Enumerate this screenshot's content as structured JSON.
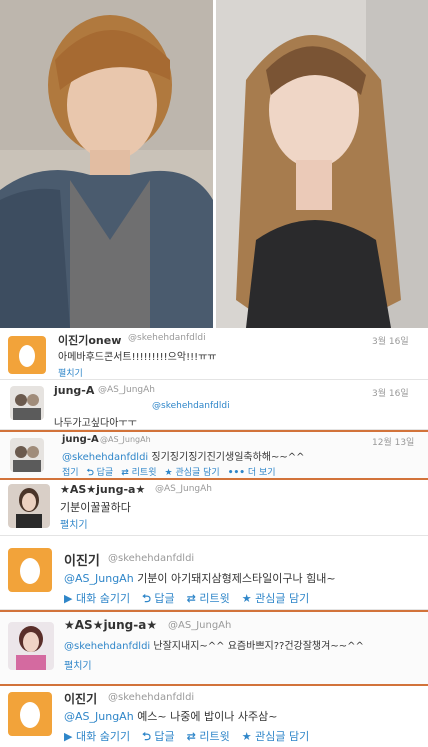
{
  "tweets": [
    {
      "name": "이진기onew",
      "handle": "@skehehdanfdldi",
      "date": "3월 16일",
      "text": "아메바후드콘서트!!!!!!!!!으악!!!ㅠㅠ",
      "expand": "펼치기"
    },
    {
      "name": "jung-A",
      "handle": "@AS_JungAh",
      "date": "3월 16일",
      "mention": "@skehehdanfdldi",
      "text": "나두가고싶다아ㅜㅜ"
    },
    {
      "name": "jung-A",
      "handle": "@AS_JungAh",
      "date": "12월 13일",
      "mention": "@skehehdanfdldi",
      "text": "징기징기징기진기생일축하해~~^^",
      "actions": [
        "접기",
        "답글",
        "리트윗",
        "관심글 담기",
        "더 보기"
      ]
    },
    {
      "name": "★AS★jung-a★",
      "handle": "@AS_JungAh",
      "text": "기분이꿀꿀하다",
      "expand": "펼치기"
    },
    {
      "name": "이진기",
      "handle": "@skehehdanfdldi",
      "mention": "@AS_JungAh",
      "text": "기분이 아기돼지삼형제스타일이구나 힘내~",
      "actions": [
        "대화 숨기기",
        "답글",
        "리트윗",
        "관심글 담기"
      ]
    },
    {
      "name": "★AS★jung-a★",
      "handle": "@AS_JungAh",
      "mention": "@skehehdanfdldi",
      "text": "난잘지내지~^^ 요즘바쁘지??건강잘챙겨~~^^",
      "expand": "펼치기"
    },
    {
      "name": "이진기",
      "handle": "@skehehdanfdldi",
      "mention": "@AS_JungAh",
      "text": "예스~ 나중에 밥이나 사주삼~",
      "actions": [
        "대화 숨기기",
        "답글",
        "리트윗",
        "관심글 담기"
      ]
    }
  ],
  "icons": {
    "egg": "egg-icon",
    "reply": "reply-icon",
    "retweet": "retweet-icon",
    "favorite": "star-icon",
    "more": "more-icon",
    "collapse": "collapse-icon"
  },
  "colors": {
    "accent": "#2f86c9",
    "highlight": "#d2733a",
    "egg": "#f2a33a"
  }
}
